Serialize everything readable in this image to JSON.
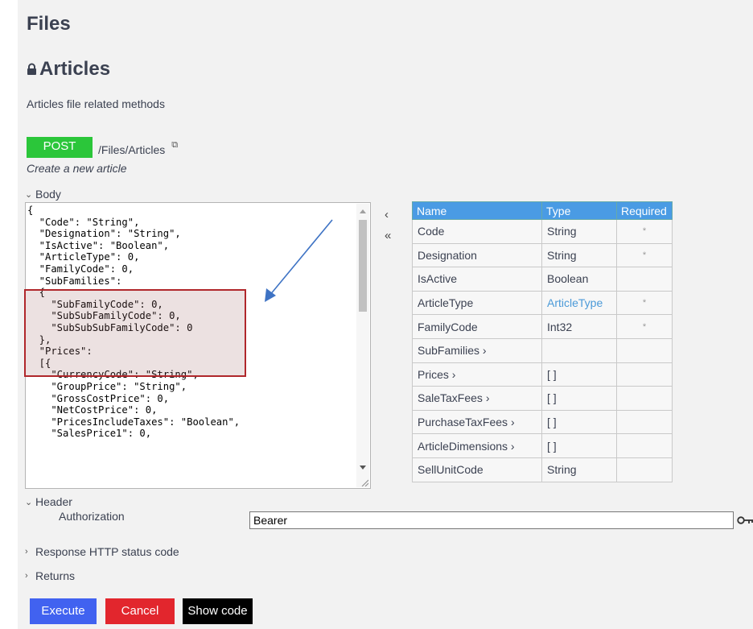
{
  "section_title": "Files",
  "tag": {
    "title": "Articles",
    "description": "Articles file related methods"
  },
  "endpoint": {
    "method": "POST",
    "path": "/Files/Articles",
    "summary": "Create a new article"
  },
  "body": {
    "label": "Body",
    "code_lines": [
      "{",
      "  \"Code\": \"String\",",
      "  \"Designation\": \"String\",",
      "  \"IsActive\": \"Boolean\",",
      "  \"ArticleType\": 0,",
      "  \"FamilyCode\": 0,",
      "  \"SubFamilies\":",
      "  {",
      "    \"SubFamilyCode\": 0,",
      "    \"SubSubFamilyCode\": 0,",
      "    \"SubSubSubFamilyCode\": 0",
      "  },",
      "  \"Prices\":",
      "  [{",
      "    \"CurrencyCode\": \"String\",",
      "    \"GroupPrice\": \"String\",",
      "    \"GrossCostPrice\": 0,",
      "    \"NetCostPrice\": 0,",
      "    \"PricesIncludeTaxes\": \"Boolean\",",
      "    \"SalesPrice1\": 0,"
    ]
  },
  "nav": {
    "back": "‹",
    "back_all": "«"
  },
  "schema": {
    "headers": {
      "name": "Name",
      "type": "Type",
      "required": "Required"
    },
    "rows": [
      {
        "name": "Code",
        "type": "String",
        "required": "*"
      },
      {
        "name": "Designation",
        "type": "String",
        "required": "*"
      },
      {
        "name": "IsActive",
        "type": "Boolean",
        "required": ""
      },
      {
        "name": "ArticleType",
        "type": "ArticleType",
        "required": "*"
      },
      {
        "name": "FamilyCode",
        "type": "Int32",
        "required": "*"
      },
      {
        "name": "SubFamilies ›",
        "type": "",
        "required": ""
      },
      {
        "name": "Prices ›",
        "type": "[ ]",
        "required": ""
      },
      {
        "name": "SaleTaxFees ›",
        "type": "[ ]",
        "required": ""
      },
      {
        "name": "PurchaseTaxFees ›",
        "type": "[ ]",
        "required": ""
      },
      {
        "name": "ArticleDimensions ›",
        "type": "[ ]",
        "required": ""
      },
      {
        "name": "SellUnitCode",
        "type": "String",
        "required": ""
      }
    ]
  },
  "header_section": {
    "label": "Header",
    "auth_label": "Authorization",
    "auth_value": "Bearer"
  },
  "response_label": "Response HTTP status code",
  "returns_label": "Returns",
  "buttons": {
    "execute": "Execute",
    "cancel": "Cancel",
    "show_code": "Show code"
  },
  "icons": {
    "lock": "lock-icon",
    "copy": "copy-icon",
    "key": "key-icon",
    "chevron_down": "chevron-down-icon",
    "chevron_right": "chevron-right-icon"
  },
  "colors": {
    "post": "#2bc63a",
    "execute": "#4162f0",
    "cancel": "#e2262d",
    "show_code": "#000000",
    "table_header": "#4a9be4",
    "highlight_border": "#b0272b",
    "annotation_arrow": "#3e73c4"
  }
}
